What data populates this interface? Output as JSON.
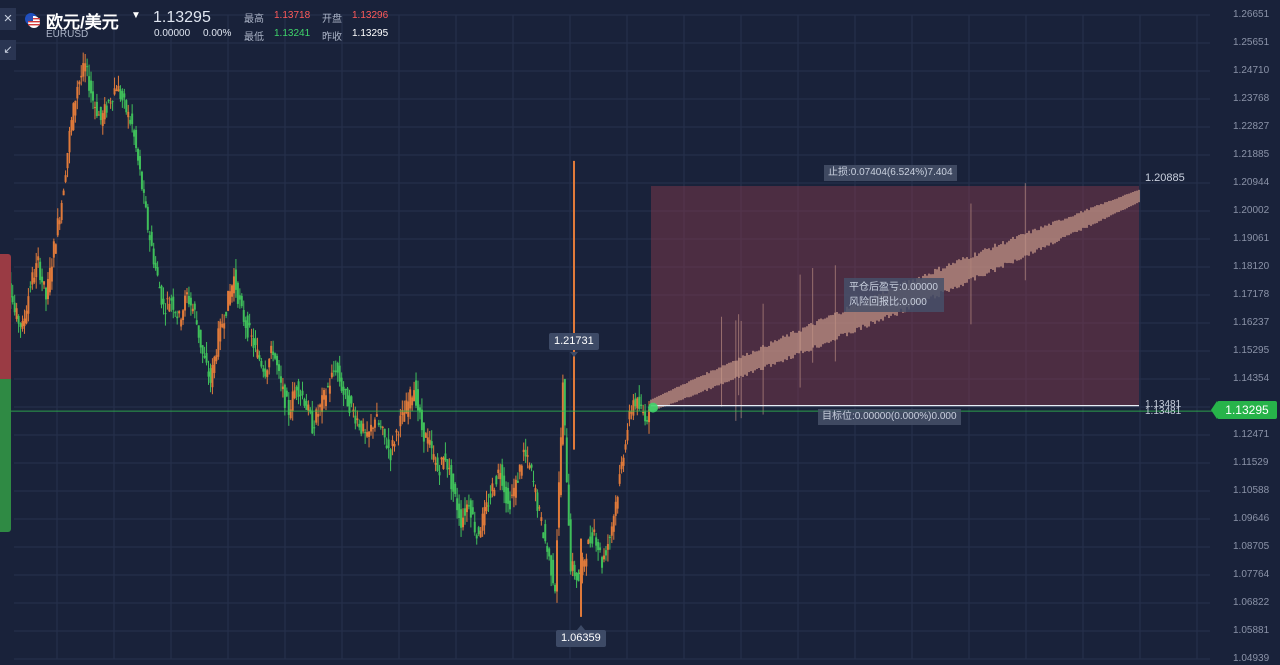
{
  "header": {
    "close_icon": "×",
    "shrink_icon": "↙",
    "symbol_name": "欧元/美元",
    "symbol_code": "EURUSD",
    "last_price": "1.13295",
    "change_abs": "0.00000",
    "change_pct": "0.00%",
    "high_label": "最高",
    "high_value": "1.13718",
    "open_label": "开盘",
    "open_value": "1.13296",
    "low_label": "最低",
    "low_value": "1.13241",
    "prev_close_label": "昨收",
    "prev_close_value": "1.13295"
  },
  "colors": {
    "background": "#19223a",
    "up": "#ff5a5a",
    "down": "#3fd46a",
    "badge": "#27b34a",
    "stop_zone": "#8b3b4e"
  },
  "axis": {
    "y_ticks": [
      "1.26651",
      "1.25651",
      "1.24710",
      "1.23768",
      "1.22827",
      "1.21885",
      "1.20944",
      "1.20002",
      "1.19061",
      "1.18120",
      "1.17178",
      "1.16237",
      "1.15295",
      "1.14354",
      "1.13412",
      "1.12471",
      "1.11529",
      "1.10588",
      "1.09646",
      "1.08705",
      "1.07764",
      "1.06822",
      "1.05881",
      "1.04939"
    ],
    "current_price_badge": "1.13295"
  },
  "annotations": {
    "high_tooltip": "1.21731",
    "low_tooltip": "1.06359",
    "stop_loss_label": "止损:0.07404(6.524%)7.404",
    "stop_price": "1.20885",
    "target_label": "目标位:0.00000(0.000%)0.000",
    "entry_price_a": "1.13481",
    "entry_price_b": "1.13481",
    "pnl_label": "平仓后盈亏:0.00000",
    "risk_ratio_label": "风险回报比:0.000"
  },
  "chart_data": {
    "type": "line",
    "y_axis_range": [
      1.04939,
      1.26651
    ],
    "current_price": 1.13295,
    "entry_price": 1.13481,
    "stop_price": 1.20885,
    "period_high": 1.21731,
    "period_low": 1.06359,
    "series": [
      {
        "values": [
          1.174,
          1.182,
          1.166,
          1.161,
          1.176,
          1.183,
          1.171,
          1.188,
          1.204,
          1.226,
          1.243,
          1.249,
          1.238,
          1.231,
          1.237,
          1.243,
          1.236,
          1.229,
          1.213,
          1.195,
          1.181,
          1.168,
          1.171,
          1.164,
          1.172,
          1.166,
          1.152,
          1.143,
          1.158,
          1.168,
          1.178,
          1.166,
          1.159,
          1.152,
          1.147,
          1.154,
          1.141,
          1.133,
          1.142,
          1.137,
          1.128,
          1.134,
          1.141,
          1.148,
          1.139,
          1.134,
          1.129,
          1.123,
          1.131,
          1.125,
          1.119,
          1.128,
          1.134,
          1.141,
          1.127,
          1.121,
          1.113,
          1.118,
          1.106,
          1.096,
          1.103,
          1.091,
          1.098,
          1.107,
          1.114,
          1.101,
          1.108,
          1.119,
          1.112,
          1.098,
          1.086,
          1.074,
          1.141,
          1.081,
          1.076,
          1.086,
          1.093,
          1.082,
          1.091,
          1.106,
          1.124,
          1.137,
          1.133,
          1.131
        ]
      }
    ]
  }
}
